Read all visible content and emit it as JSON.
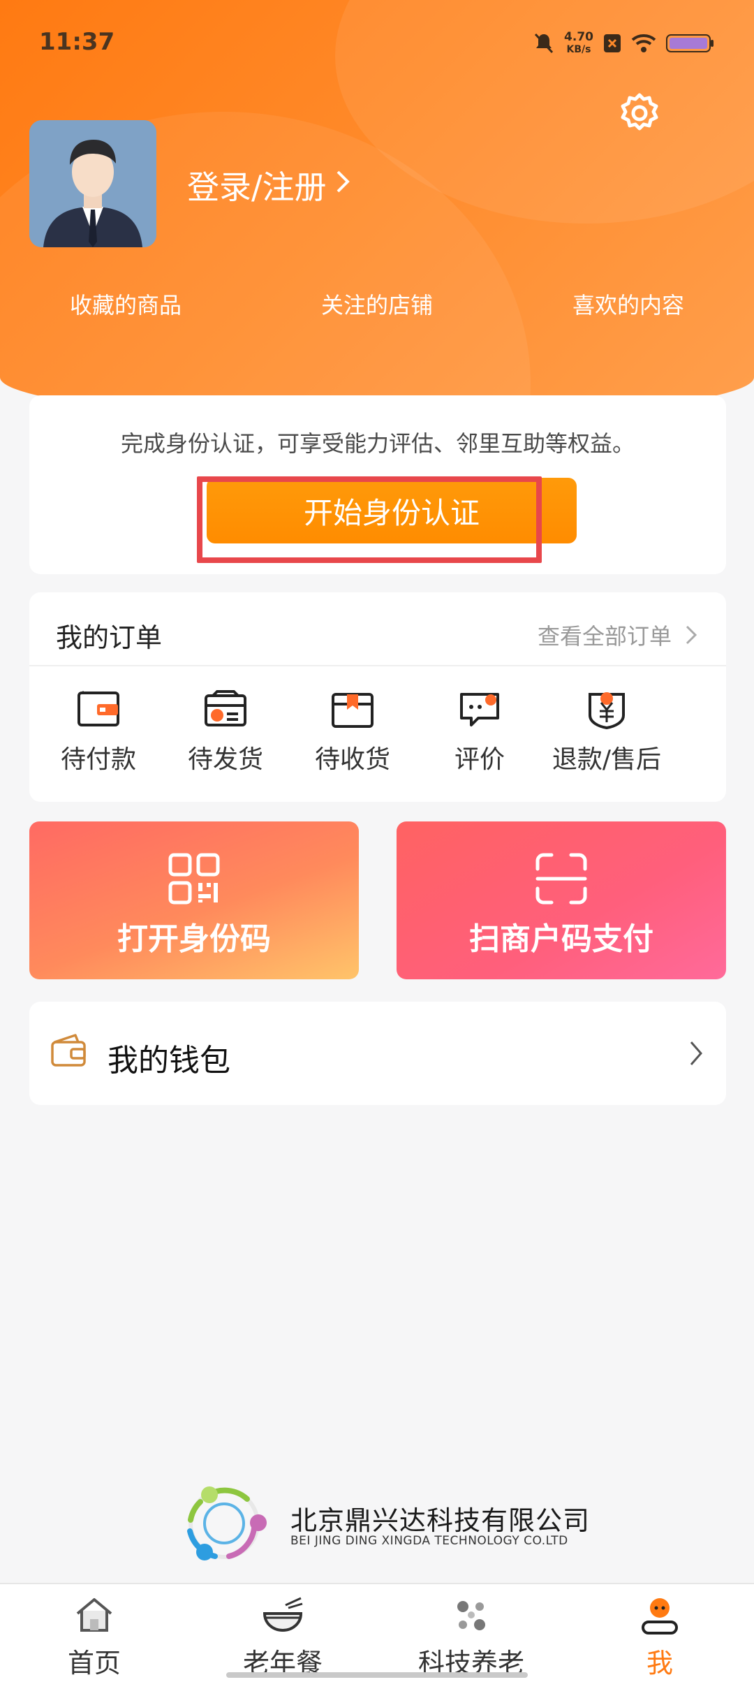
{
  "status_bar": {
    "time": "11:37",
    "net_speed": "4.70",
    "net_unit": "KB/s"
  },
  "profile": {
    "login_label": "登录/注册"
  },
  "quick_links": [
    "收藏的商品",
    "关注的店铺",
    "喜欢的内容"
  ],
  "verification": {
    "tip": "完成身份认证，可享受能力评估、邻里互助等权益。",
    "button_label": "开始身份认证"
  },
  "orders": {
    "title": "我的订单",
    "view_all": "查看全部订单",
    "items": [
      {
        "label": "待付款",
        "icon": "wallet-icon"
      },
      {
        "label": "待发货",
        "icon": "card-box-icon"
      },
      {
        "label": "待收货",
        "icon": "package-icon"
      },
      {
        "label": "评价",
        "icon": "comment-icon"
      },
      {
        "label": "退款/售后",
        "icon": "refund-icon"
      }
    ]
  },
  "tiles": {
    "id_code": "打开身份码",
    "scan_pay": "扫商户码支付"
  },
  "wallet": {
    "label": "我的钱包"
  },
  "company": {
    "name_cn": "北京鼎兴达科技有限公司",
    "name_en": "BEI JING DING XINGDA TECHNOLOGY CO.LTD"
  },
  "tabs": [
    {
      "label": "首页",
      "icon": "home-icon"
    },
    {
      "label": "老年餐",
      "icon": "bowl-icon"
    },
    {
      "label": "科技养老",
      "icon": "dots-icon"
    },
    {
      "label": "我",
      "icon": "person-icon",
      "active": true
    }
  ],
  "colors": {
    "accent": "#ff7a12",
    "button": "#ff8c00",
    "highlight": "#e8474b"
  }
}
